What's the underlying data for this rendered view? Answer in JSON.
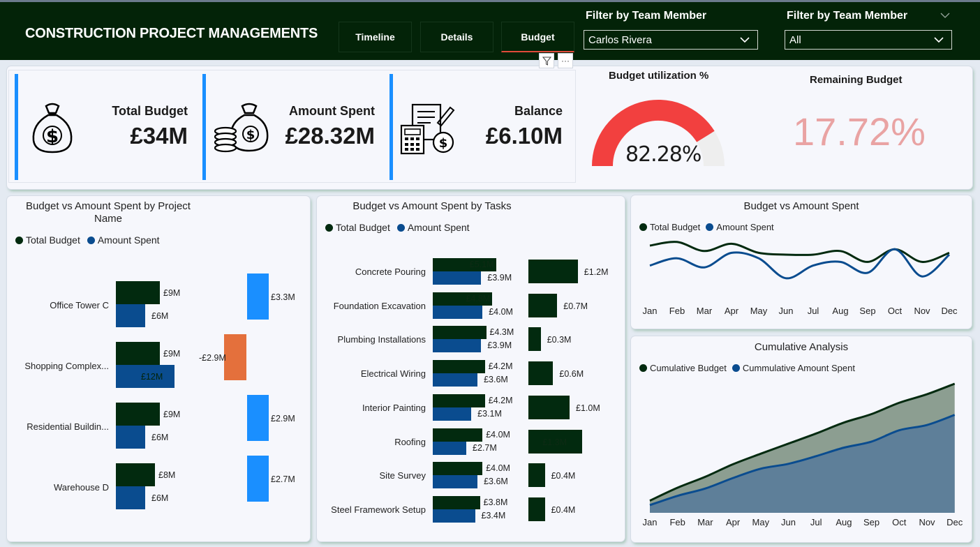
{
  "header": {
    "title": "CONSTRUCTION PROJECT MANAGEMENTS",
    "tabs": [
      {
        "label": "Timeline"
      },
      {
        "label": "Details"
      },
      {
        "label": "Budget"
      }
    ],
    "filters": [
      {
        "label": "Filter by Team Member",
        "value": "Carlos Rivera"
      },
      {
        "label": "Filter by Team Member",
        "value": "All"
      }
    ]
  },
  "kpis": [
    {
      "label": "Total Budget",
      "value": "£34M"
    },
    {
      "label": "Amount Spent",
      "value": "£28.32M"
    },
    {
      "label": "Balance",
      "value": "£6.10M"
    }
  ],
  "gauge": {
    "title": "Budget utilization %",
    "value_text": "82.28%",
    "value": 82.28
  },
  "remaining": {
    "title": "Remaining Budget",
    "value": "17.72%"
  },
  "colors": {
    "budget": "#022a0f",
    "spent": "#0a4c8f",
    "diff_positive": "#1a8fff",
    "diff_negative": "#e4703c",
    "gauge": "#f2403f",
    "remaining": "#e9a3a3"
  },
  "project_chart": {
    "title": "Budget vs Amount Spent by Project Name",
    "legend": [
      "Total Budget",
      "Amount Spent"
    ],
    "rows": [
      {
        "name": "Office Tower C",
        "budget_label": "£9M",
        "spent_label": "£6M",
        "diff_label": "£3.3M"
      },
      {
        "name": "Shopping Complex...",
        "budget_label": "£9M",
        "spent_label": "£12M",
        "diff_label": "-£2.9M"
      },
      {
        "name": "Residential Buildin...",
        "budget_label": "£9M",
        "spent_label": "£6M",
        "diff_label": "£2.9M"
      },
      {
        "name": "Warehouse D",
        "budget_label": "£8M",
        "spent_label": "£6M",
        "diff_label": "£2.7M"
      }
    ]
  },
  "task_chart": {
    "title": "Budget vs Amount Spent by Tasks",
    "legend": [
      "Total Budget",
      "Amount Spent"
    ],
    "rows": [
      {
        "name": "Concrete Pouring",
        "budget_label": "£5.1M",
        "spent_label": "£3.9M",
        "diff_label": "£1.2M"
      },
      {
        "name": "Foundation Excavation",
        "budget_label": "£4.8M",
        "spent_label": "£4.0M",
        "diff_label": "£0.7M"
      },
      {
        "name": "Plumbing Installations",
        "budget_label": "£4.3M",
        "spent_label": "£3.9M",
        "diff_label": "£0.3M"
      },
      {
        "name": "Electrical Wiring",
        "budget_label": "£4.2M",
        "spent_label": "£3.6M",
        "diff_label": "£0.6M"
      },
      {
        "name": "Interior Painting",
        "budget_label": "£4.2M",
        "spent_label": "£3.1M",
        "diff_label": "£1.0M"
      },
      {
        "name": "Roofing",
        "budget_label": "£4.0M",
        "spent_label": "£2.7M",
        "diff_label": "£1.3M"
      },
      {
        "name": "Site Survey",
        "budget_label": "£4.0M",
        "spent_label": "£3.6M",
        "diff_label": "£0.4M"
      },
      {
        "name": "Steel Framework Setup",
        "budget_label": "£3.8M",
        "spent_label": "£3.4M",
        "diff_label": "£0.4M"
      }
    ]
  },
  "line_chart": {
    "title": "Budget vs Amount Spent",
    "legend": [
      "Total Budget",
      "Amount Spent"
    ],
    "months": [
      "Jan",
      "Feb",
      "Mar",
      "Apr",
      "May",
      "Jun",
      "Jul",
      "Aug",
      "Sep",
      "Oct",
      "Nov",
      "Dec"
    ]
  },
  "cumulative_chart": {
    "title": "Cumulative Analysis",
    "legend": [
      "Cumulative Budget",
      "Cummulative Amount Spent"
    ],
    "months": [
      "Jan",
      "Feb",
      "Mar",
      "Apr",
      "May",
      "Jun",
      "Jul",
      "Aug",
      "Sep",
      "Oct",
      "Nov",
      "Dec"
    ]
  },
  "chart_data": [
    {
      "type": "bar",
      "title": "Budget vs Amount Spent by Project Name",
      "categories": [
        "Office Tower C",
        "Shopping Complex...",
        "Residential Buildin...",
        "Warehouse D"
      ],
      "series": [
        {
          "name": "Total Budget",
          "values": [
            9,
            9,
            9,
            8
          ]
        },
        {
          "name": "Amount Spent",
          "values": [
            6,
            12,
            6,
            6
          ]
        }
      ],
      "difference": [
        3.3,
        -2.9,
        2.9,
        2.7
      ],
      "unit": "£M"
    },
    {
      "type": "bar",
      "title": "Budget vs Amount Spent by Tasks",
      "categories": [
        "Concrete Pouring",
        "Foundation Excavation",
        "Plumbing Installations",
        "Electrical Wiring",
        "Interior Painting",
        "Roofing",
        "Site Survey",
        "Steel Framework Setup"
      ],
      "series": [
        {
          "name": "Total Budget",
          "values": [
            5.1,
            4.8,
            4.3,
            4.2,
            4.2,
            4.0,
            4.0,
            3.8
          ]
        },
        {
          "name": "Amount Spent",
          "values": [
            3.9,
            4.0,
            3.9,
            3.6,
            3.1,
            2.7,
            3.6,
            3.4
          ]
        }
      ],
      "difference": [
        1.2,
        0.7,
        0.3,
        0.6,
        1.0,
        1.3,
        0.4,
        0.4
      ],
      "unit": "£M"
    },
    {
      "type": "line",
      "title": "Budget vs Amount Spent",
      "x": [
        "Jan",
        "Feb",
        "Mar",
        "Apr",
        "May",
        "Jun",
        "Jul",
        "Aug",
        "Sep",
        "Oct",
        "Nov",
        "Dec"
      ],
      "series": [
        {
          "name": "Total Budget",
          "values": [
            3.0,
            3.2,
            2.7,
            3.1,
            2.6,
            2.5,
            2.5,
            2.7,
            2.1,
            2.8,
            2.1,
            2.6
          ]
        },
        {
          "name": "Amount Spent",
          "values": [
            1.9,
            2.3,
            1.8,
            2.6,
            2.3,
            1.2,
            1.9,
            2.1,
            1.5,
            2.8,
            1.3,
            2.5
          ]
        }
      ],
      "grid": false
    },
    {
      "type": "area",
      "title": "Cumulative Analysis",
      "x": [
        "Jan",
        "Feb",
        "Mar",
        "Apr",
        "May",
        "Jun",
        "Jul",
        "Aug",
        "Sep",
        "Oct",
        "Nov",
        "Dec"
      ],
      "series": [
        {
          "name": "Cumulative Budget",
          "values": [
            3.0,
            6.2,
            8.9,
            12.0,
            14.6,
            17.1,
            19.6,
            22.3,
            24.4,
            27.2,
            29.3,
            31.9
          ]
        },
        {
          "name": "Cummulative Amount Spent",
          "values": [
            1.9,
            4.2,
            6.0,
            8.6,
            10.9,
            12.1,
            14.0,
            16.1,
            17.6,
            20.4,
            21.7,
            24.2
          ]
        }
      ],
      "grid": false
    }
  ]
}
